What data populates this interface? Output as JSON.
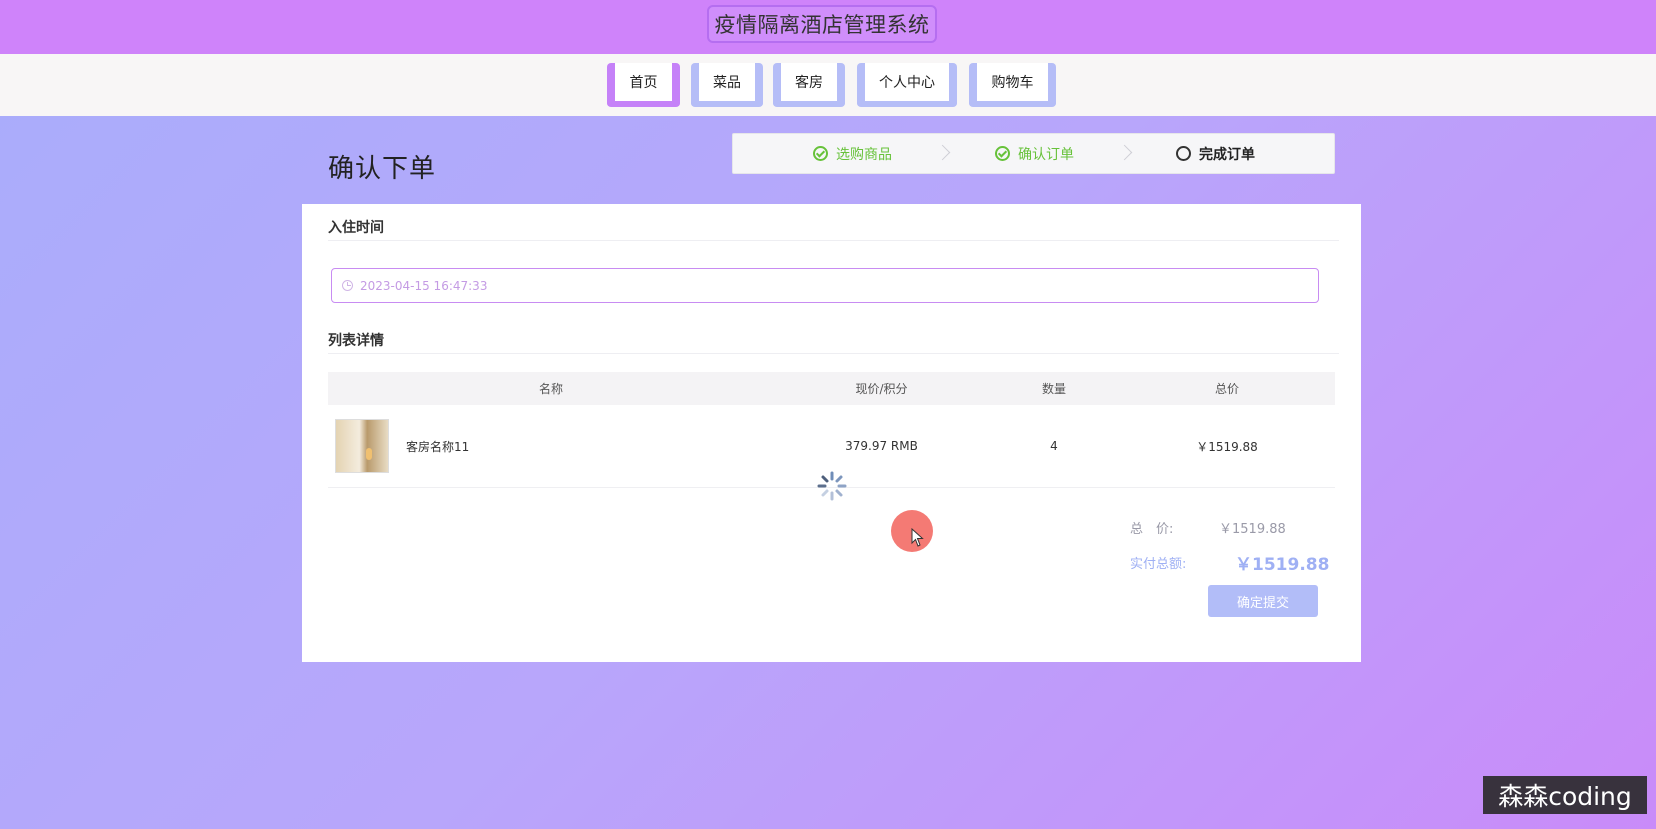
{
  "app": {
    "title": "疫情隔离酒店管理系统"
  },
  "nav": {
    "items": [
      {
        "label": "首页",
        "active": true
      },
      {
        "label": "菜品",
        "active": false
      },
      {
        "label": "客房",
        "active": false
      },
      {
        "label": "个人中心",
        "active": false
      },
      {
        "label": "购物车",
        "active": false
      }
    ]
  },
  "page": {
    "title": "确认下单"
  },
  "steps": [
    {
      "label": "选购商品",
      "status": "done"
    },
    {
      "label": "确认订单",
      "status": "done"
    },
    {
      "label": "完成订单",
      "status": "current"
    }
  ],
  "checkin": {
    "section_title": "入住时间",
    "value": "2023-04-15 16:47:33"
  },
  "list": {
    "section_title": "列表详情",
    "headers": [
      "名称",
      "现价/积分",
      "数量",
      "总价"
    ],
    "rows": [
      {
        "name": "客房名称11",
        "price": "379.97 RMB",
        "quantity": "4",
        "total": "￥1519.88"
      }
    ]
  },
  "summary": {
    "total_label": "总　价:",
    "total_value": "￥1519.88",
    "pay_label": "实付总额:",
    "pay_value": "￥1519.88",
    "submit_label": "确定提交"
  },
  "watermark": "森森coding",
  "colors": {
    "header_bg": "#cf83fa",
    "nav_active": "#c581f8",
    "nav_inactive": "#b5bdf7",
    "step_done": "#67c23a",
    "primary_light": "#b2bdf8"
  }
}
